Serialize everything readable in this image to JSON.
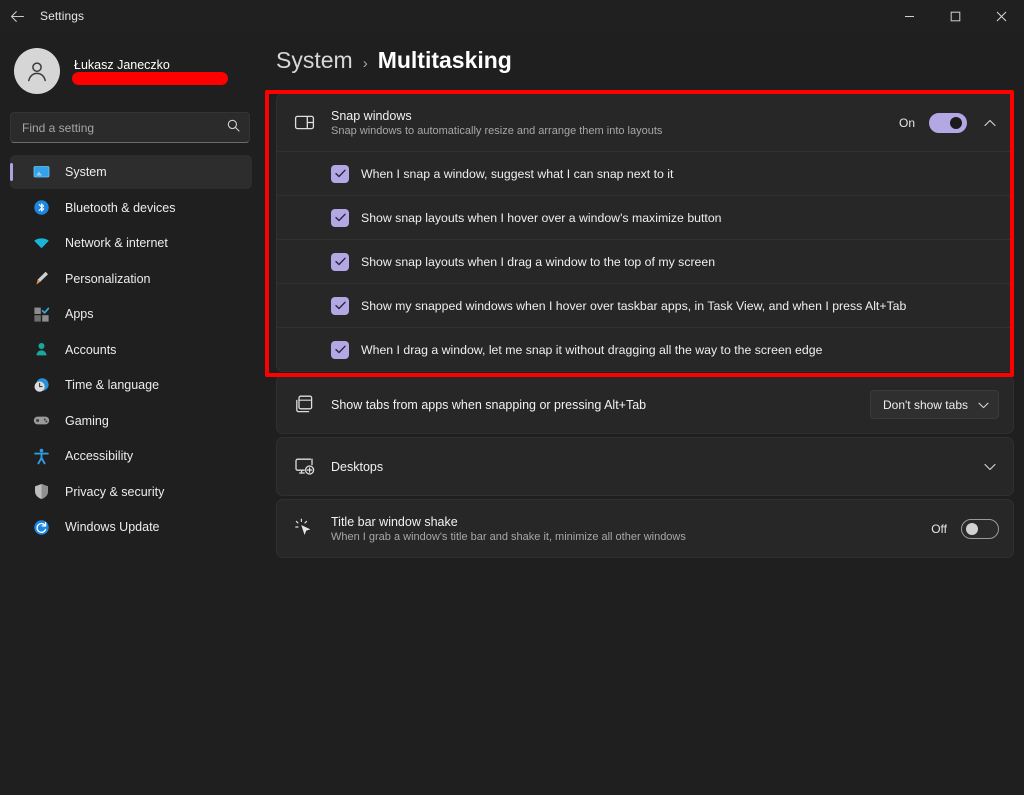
{
  "window": {
    "title": "Settings",
    "back_label": "Back",
    "minimize_label": "Minimize",
    "maximize_label": "Maximize",
    "close_label": "Close"
  },
  "account": {
    "name": "Łukasz Janeczko",
    "email": "",
    "redacted": true
  },
  "search": {
    "placeholder": "Find a setting",
    "value": "",
    "icon": "search-icon"
  },
  "sidebar": {
    "items": [
      {
        "label": "System",
        "icon": "system-icon",
        "selected": true
      },
      {
        "label": "Bluetooth & devices",
        "icon": "bluetooth-icon",
        "selected": false
      },
      {
        "label": "Network & internet",
        "icon": "wifi-icon",
        "selected": false
      },
      {
        "label": "Personalization",
        "icon": "paintbrush-icon",
        "selected": false
      },
      {
        "label": "Apps",
        "icon": "apps-icon",
        "selected": false
      },
      {
        "label": "Accounts",
        "icon": "person-icon",
        "selected": false
      },
      {
        "label": "Time & language",
        "icon": "clock-icon",
        "selected": false
      },
      {
        "label": "Gaming",
        "icon": "gamepad-icon",
        "selected": false
      },
      {
        "label": "Accessibility",
        "icon": "accessibility-icon",
        "selected": false
      },
      {
        "label": "Privacy & security",
        "icon": "shield-icon",
        "selected": false
      },
      {
        "label": "Windows Update",
        "icon": "update-icon",
        "selected": false
      }
    ]
  },
  "breadcrumb": {
    "parent": "System",
    "separator": "›",
    "current": "Multitasking"
  },
  "snap_windows": {
    "title": "Snap windows",
    "subtitle": "Snap windows to automatically resize and arrange them into layouts",
    "icon": "snap-layout-icon",
    "toggle_label": "On",
    "toggle_state": "on",
    "expand_icon": "chevron-up-icon",
    "options": [
      {
        "label": "When I snap a window, suggest what I can snap next to it",
        "checked": true
      },
      {
        "label": "Show snap layouts when I hover over a window's maximize button",
        "checked": true
      },
      {
        "label": "Show snap layouts when I drag a window to the top of my screen",
        "checked": true
      },
      {
        "label": "Show my snapped windows when I hover over taskbar apps, in Task View, and when I press Alt+Tab",
        "checked": true
      },
      {
        "label": "When I drag a window, let me snap it without dragging all the way to the screen edge",
        "checked": true
      }
    ]
  },
  "show_tabs": {
    "title": "Show tabs from apps when snapping or pressing Alt+Tab",
    "icon": "tabs-stack-icon",
    "dropdown_value": "Don't show tabs",
    "dropdown_icon": "chevron-down-icon"
  },
  "desktops": {
    "title": "Desktops",
    "icon": "desktop-add-icon",
    "expand_icon": "chevron-down-icon"
  },
  "title_bar_shake": {
    "title": "Title bar window shake",
    "subtitle": "When I grab a window's title bar and shake it, minimize all other windows",
    "icon": "cursor-shake-icon",
    "toggle_label": "Off",
    "toggle_state": "off"
  },
  "annotation": {
    "color": "#fe0000",
    "shape": "rectangle-highlight"
  },
  "colors": {
    "accent": "#b3a8e3",
    "window_bg": "#1f1f1f",
    "card_bg": "#272727",
    "annotation": "#fe0000"
  }
}
